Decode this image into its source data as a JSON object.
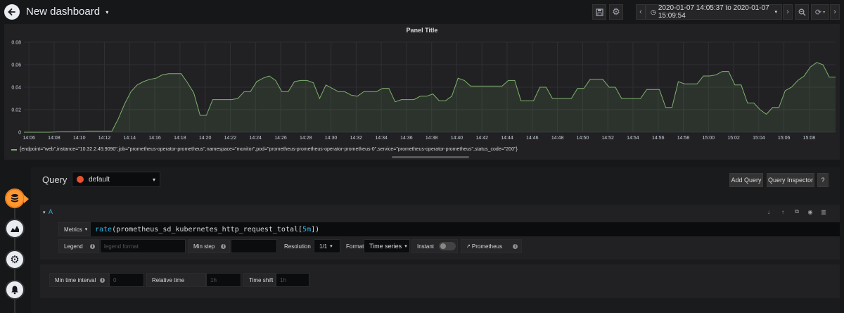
{
  "header": {
    "title": "New dashboard",
    "time_range": "2020-01-07 14:05:37 to 2020-01-07 15:09:54"
  },
  "panel": {
    "title": "Panel Title",
    "legend": "{endpoint=\"web\",instance=\"10.32.2.45:9090\",job=\"prometheus-operator-prometheus\",namespace=\"monitor\",pod=\"prometheus-prometheus-operator-prometheus-0\",service=\"prometheus-operator-prometheus\",status_code=\"200\"}"
  },
  "chart_data": {
    "type": "area",
    "x_ticks": [
      "14:06",
      "14:08",
      "14:10",
      "14:12",
      "14:14",
      "14:16",
      "14:18",
      "14:20",
      "14:22",
      "14:24",
      "14:26",
      "14:28",
      "14:30",
      "14:32",
      "14:34",
      "14:36",
      "14:38",
      "14:40",
      "14:42",
      "14:44",
      "14:46",
      "14:48",
      "14:50",
      "14:52",
      "14:54",
      "14:56",
      "14:58",
      "15:00",
      "15:02",
      "15:04",
      "15:06",
      "15:08"
    ],
    "y_ticks": [
      "0",
      "0.02",
      "0.04",
      "0.06",
      "0.08"
    ],
    "ylim": [
      0,
      0.08
    ],
    "series_color": "#7eb26d",
    "grid": true,
    "series": [
      {
        "x_minutes": [
          0,
          1,
          2,
          3,
          4,
          5,
          6,
          7,
          7.5,
          8,
          8.5,
          9,
          9.5,
          10,
          10.5,
          11,
          11.5,
          12,
          12.5,
          13,
          13.5,
          14,
          14.5,
          15,
          15.5,
          16,
          16.5,
          17,
          17.5,
          18,
          18.5,
          19,
          19.5,
          20,
          20.5,
          21,
          21.5,
          22,
          22.5,
          23,
          23.5,
          24,
          24.5,
          25,
          25.5,
          26,
          26.5,
          27,
          27.5,
          28,
          28.5,
          29,
          29.5,
          30,
          30.5,
          31,
          31.5,
          32,
          32.5,
          33,
          33.5,
          34,
          34.5,
          35,
          35.5,
          36,
          36.5,
          37,
          37.5,
          38,
          38.5,
          39,
          39.5,
          40,
          40.5,
          41,
          41.5,
          42,
          42.5,
          43,
          43.5,
          44,
          44.5,
          45,
          45.5,
          46,
          46.5,
          47,
          47.5,
          48,
          48.5,
          49,
          49.5,
          50,
          50.5,
          51,
          51.5,
          52,
          52.5,
          53,
          53.5,
          54,
          54.5,
          55,
          55.5,
          56,
          56.5,
          57,
          57.5,
          58,
          58.5,
          59,
          59.5,
          60,
          60.5,
          61,
          61.5,
          62,
          62.5,
          63,
          63.5,
          64,
          64.5
        ],
        "values": [
          0,
          0,
          0,
          0.0005,
          0.0005,
          0.001,
          0.001,
          0.001,
          0.012,
          0.025,
          0.036,
          0.042,
          0.045,
          0.047,
          0.048,
          0.051,
          0.052,
          0.052,
          0.052,
          0.044,
          0.035,
          0.015,
          0.015,
          0.029,
          0.029,
          0.029,
          0.029,
          0.03,
          0.036,
          0.036,
          0.045,
          0.048,
          0.05,
          0.046,
          0.036,
          0.036,
          0.045,
          0.046,
          0.046,
          0.044,
          0.03,
          0.042,
          0.039,
          0.036,
          0.036,
          0.033,
          0.032,
          0.036,
          0.036,
          0.036,
          0.039,
          0.039,
          0.027,
          0.029,
          0.029,
          0.029,
          0.032,
          0.032,
          0.034,
          0.028,
          0.028,
          0.032,
          0.048,
          0.046,
          0.041,
          0.041,
          0.041,
          0.041,
          0.041,
          0.041,
          0.046,
          0.046,
          0.028,
          0.028,
          0.028,
          0.04,
          0.04,
          0.03,
          0.03,
          0.03,
          0.03,
          0.039,
          0.039,
          0.047,
          0.047,
          0.047,
          0.04,
          0.04,
          0.03,
          0.03,
          0.03,
          0.03,
          0.038,
          0.038,
          0.038,
          0.022,
          0.022,
          0.045,
          0.043,
          0.043,
          0.043,
          0.05,
          0.05,
          0.051,
          0.054,
          0.054,
          0.042,
          0.042,
          0.026,
          0.026,
          0.02,
          0.016,
          0.022,
          0.022,
          0.037,
          0.04,
          0.046,
          0.05,
          0.058,
          0.062,
          0.06,
          0.049,
          0.049,
          0.04,
          0.028,
          0.018,
          0.013,
          0.007,
          0.011,
          0.017,
          0.025,
          0.036,
          0.052,
          0.052
        ],
        "x_start_minutes_offset_note": ""
      }
    ]
  },
  "editor": {
    "query_label": "Query",
    "datasource": "default",
    "add_query": "Add Query",
    "query_inspector": "Query Inspector",
    "help": "?",
    "row_ref": "A",
    "metrics_label": "Metrics",
    "expr_fn": "rate",
    "expr_metric": "prometheus_sd_kubernetes_http_request_total",
    "expr_range": "5m",
    "legend_label": "Legend",
    "legend_placeholder": "legend format",
    "min_step_label": "Min step",
    "resolution_label": "Resolution",
    "resolution_value": "1/1",
    "format_label": "Format",
    "format_value": "Time series",
    "instant_label": "Instant",
    "prometheus_link": "Prometheus",
    "min_interval_label": "Min time interval",
    "min_interval_placeholder": "0",
    "relative_time_label": "Relative time",
    "relative_time_placeholder": "1h",
    "time_shift_label": "Time shift",
    "time_shift_placeholder": "1h"
  }
}
